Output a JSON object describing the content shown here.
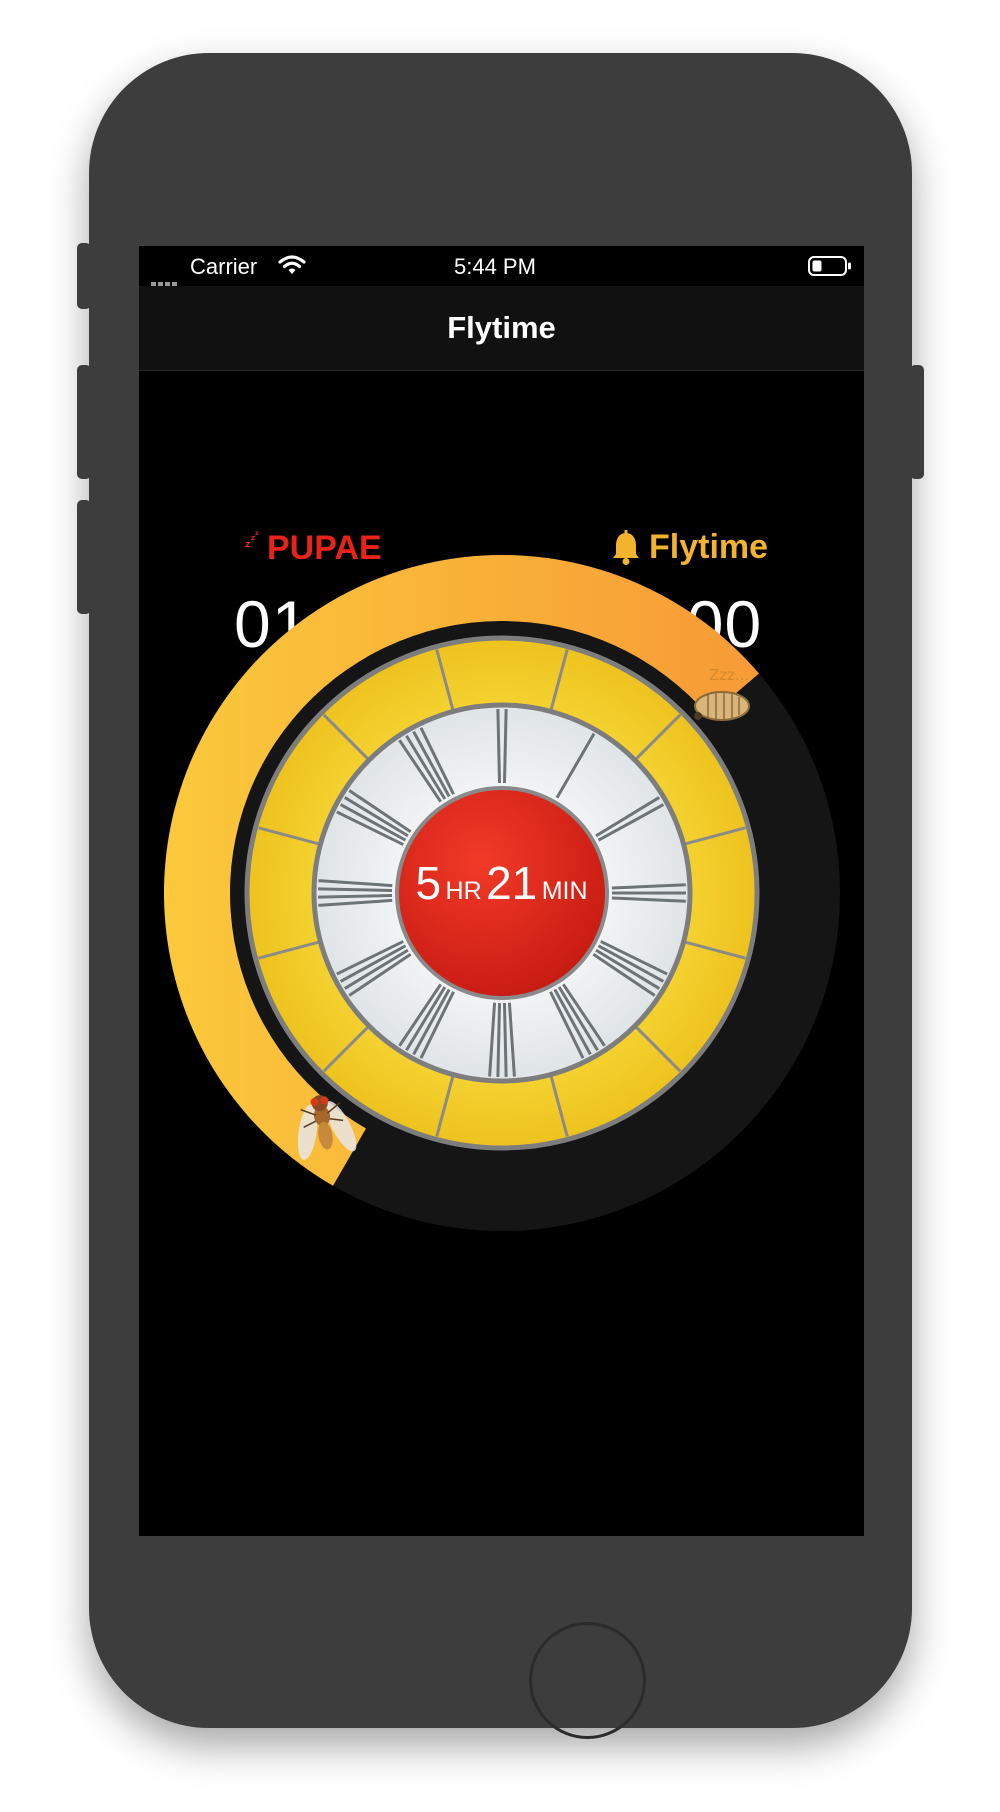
{
  "status_bar": {
    "carrier": "Carrier",
    "time": "5:44 PM"
  },
  "nav": {
    "title": "Flytime"
  },
  "bedtime": {
    "label": "PUPAE",
    "time": "01:39",
    "icon": "moon-zzz-icon",
    "color": "#e8231a"
  },
  "wake": {
    "label": "Flytime",
    "time": "07:00",
    "icon": "bell-icon",
    "color": "#f4b32f"
  },
  "sleep_duration": {
    "hours": "5",
    "hr_unit": "HR",
    "minutes": "21",
    "min_unit": "MIN"
  },
  "clock": {
    "sleeping_caption": "Zzz...",
    "arc_start_color": "#fbc93b",
    "arc_end_color": "#f79a36",
    "face_color": "#f3d02d",
    "center_color": "#e02419"
  }
}
